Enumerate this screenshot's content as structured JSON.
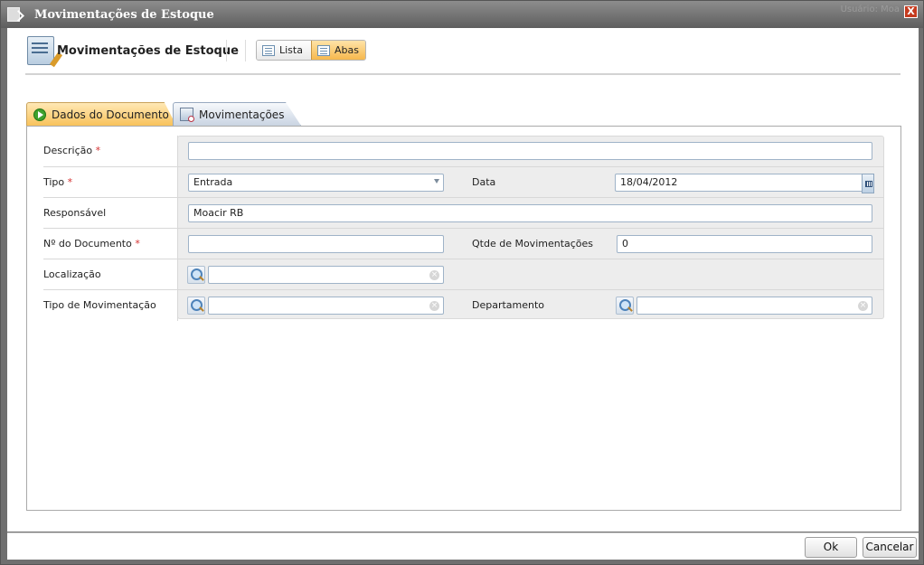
{
  "window": {
    "title": "Movimentações de Estoque",
    "user_info": "Usuário:  Moa",
    "close_label": "X"
  },
  "header": {
    "title": "Movimentações de Estoque",
    "view_toggle": {
      "lista": "Lista",
      "abas": "Abas",
      "active": "Abas"
    }
  },
  "tabs": [
    {
      "label": "Dados do Documento",
      "active": true
    },
    {
      "label": "Movimentações",
      "active": false
    }
  ],
  "form": {
    "descricao": {
      "label": "Descrição",
      "required": "*",
      "value": ""
    },
    "tipo": {
      "label": "Tipo",
      "required": "*",
      "value": "Entrada"
    },
    "data": {
      "label": "Data",
      "value": "18/04/2012"
    },
    "responsavel": {
      "label": "Responsável",
      "value": "Moacir RB"
    },
    "num_documento": {
      "label": "Nº do Documento",
      "required": "*",
      "value": ""
    },
    "qtde_movimentacoes": {
      "label": "Qtde de Movimentações",
      "value": "0"
    },
    "localizacao": {
      "label": "Localização",
      "value": ""
    },
    "tipo_movimentacao": {
      "label": "Tipo de Movimentação",
      "value": ""
    },
    "departamento": {
      "label": "Departamento",
      "value": ""
    }
  },
  "footer": {
    "ok_label": "Ok",
    "cancel_label": "Cancelar"
  }
}
